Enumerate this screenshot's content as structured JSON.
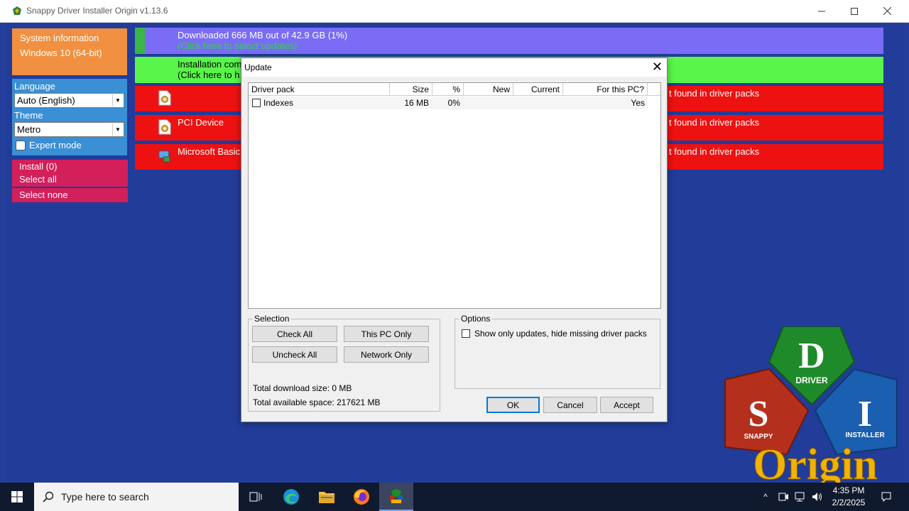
{
  "window": {
    "title": "Snappy Driver Installer Origin v1.13.6",
    "min_icon": "minimize-icon",
    "max_icon": "maximize-icon",
    "close_icon": "close-icon"
  },
  "sidebar": {
    "system_info_label": "System information",
    "os": "Windows 10 (64-bit)",
    "language_label": "Language",
    "language_value": "Auto (English)",
    "theme_label": "Theme",
    "theme_value": "Metro",
    "expert_mode": "Expert mode",
    "install": "Install (0)",
    "select_all": "Select all",
    "select_none": "Select none"
  },
  "status": {
    "download_line1": "Downloaded 666 MB out of 42.9 GB (1%)",
    "download_line2": "(Click here to select updates)",
    "install_line1": "Installation com",
    "install_line2": "(Click here to h",
    "download_progress_fraction": 0.01
  },
  "devices": [
    {
      "name": "",
      "status": "t found in driver packs",
      "icon": "driver-file-icon"
    },
    {
      "name": "PCI Device",
      "status": "t found in driver packs",
      "icon": "driver-file-icon"
    },
    {
      "name": "Microsoft Basic",
      "status": "t found in driver packs",
      "icon": "display-adapter-icon"
    }
  ],
  "dialog": {
    "title": "Update",
    "columns": [
      "Driver pack",
      "Size",
      "%",
      "New",
      "Current",
      "For this PC?"
    ],
    "rows": [
      {
        "name": "Indexes",
        "size": "16 MB",
        "pct": "0%",
        "new": "",
        "current": "",
        "for_pc": "Yes",
        "checked": false
      }
    ],
    "selection_label": "Selection",
    "check_all": "Check All",
    "this_pc_only": "This PC Only",
    "uncheck_all": "Uncheck All",
    "network_only": "Network Only",
    "total_download": "Total download size: 0 MB",
    "total_available": "Total available space: 217621 MB",
    "options_label": "Options",
    "option_show_updates": "Show only updates, hide missing driver packs",
    "ok": "OK",
    "cancel": "Cancel",
    "accept": "Accept"
  },
  "logo": {
    "d": "D",
    "driver": "DRIVER",
    "s": "S",
    "snappy": "SNAPPY",
    "i": "I",
    "installer": "INSTALLER",
    "origin": "Origin",
    "colors": {
      "green": "#1f8a2a",
      "red": "#b5301c",
      "blue": "#1a5fb0",
      "gold": "#f0b400"
    }
  },
  "taskbar": {
    "search_placeholder": "Type here to search",
    "time": "4:35 PM",
    "date": "2/2/2025",
    "icons": [
      "windows-start-icon",
      "search-icon",
      "task-view-icon",
      "edge-icon",
      "file-explorer-icon",
      "firefox-icon",
      "snappy-driver-icon"
    ]
  }
}
